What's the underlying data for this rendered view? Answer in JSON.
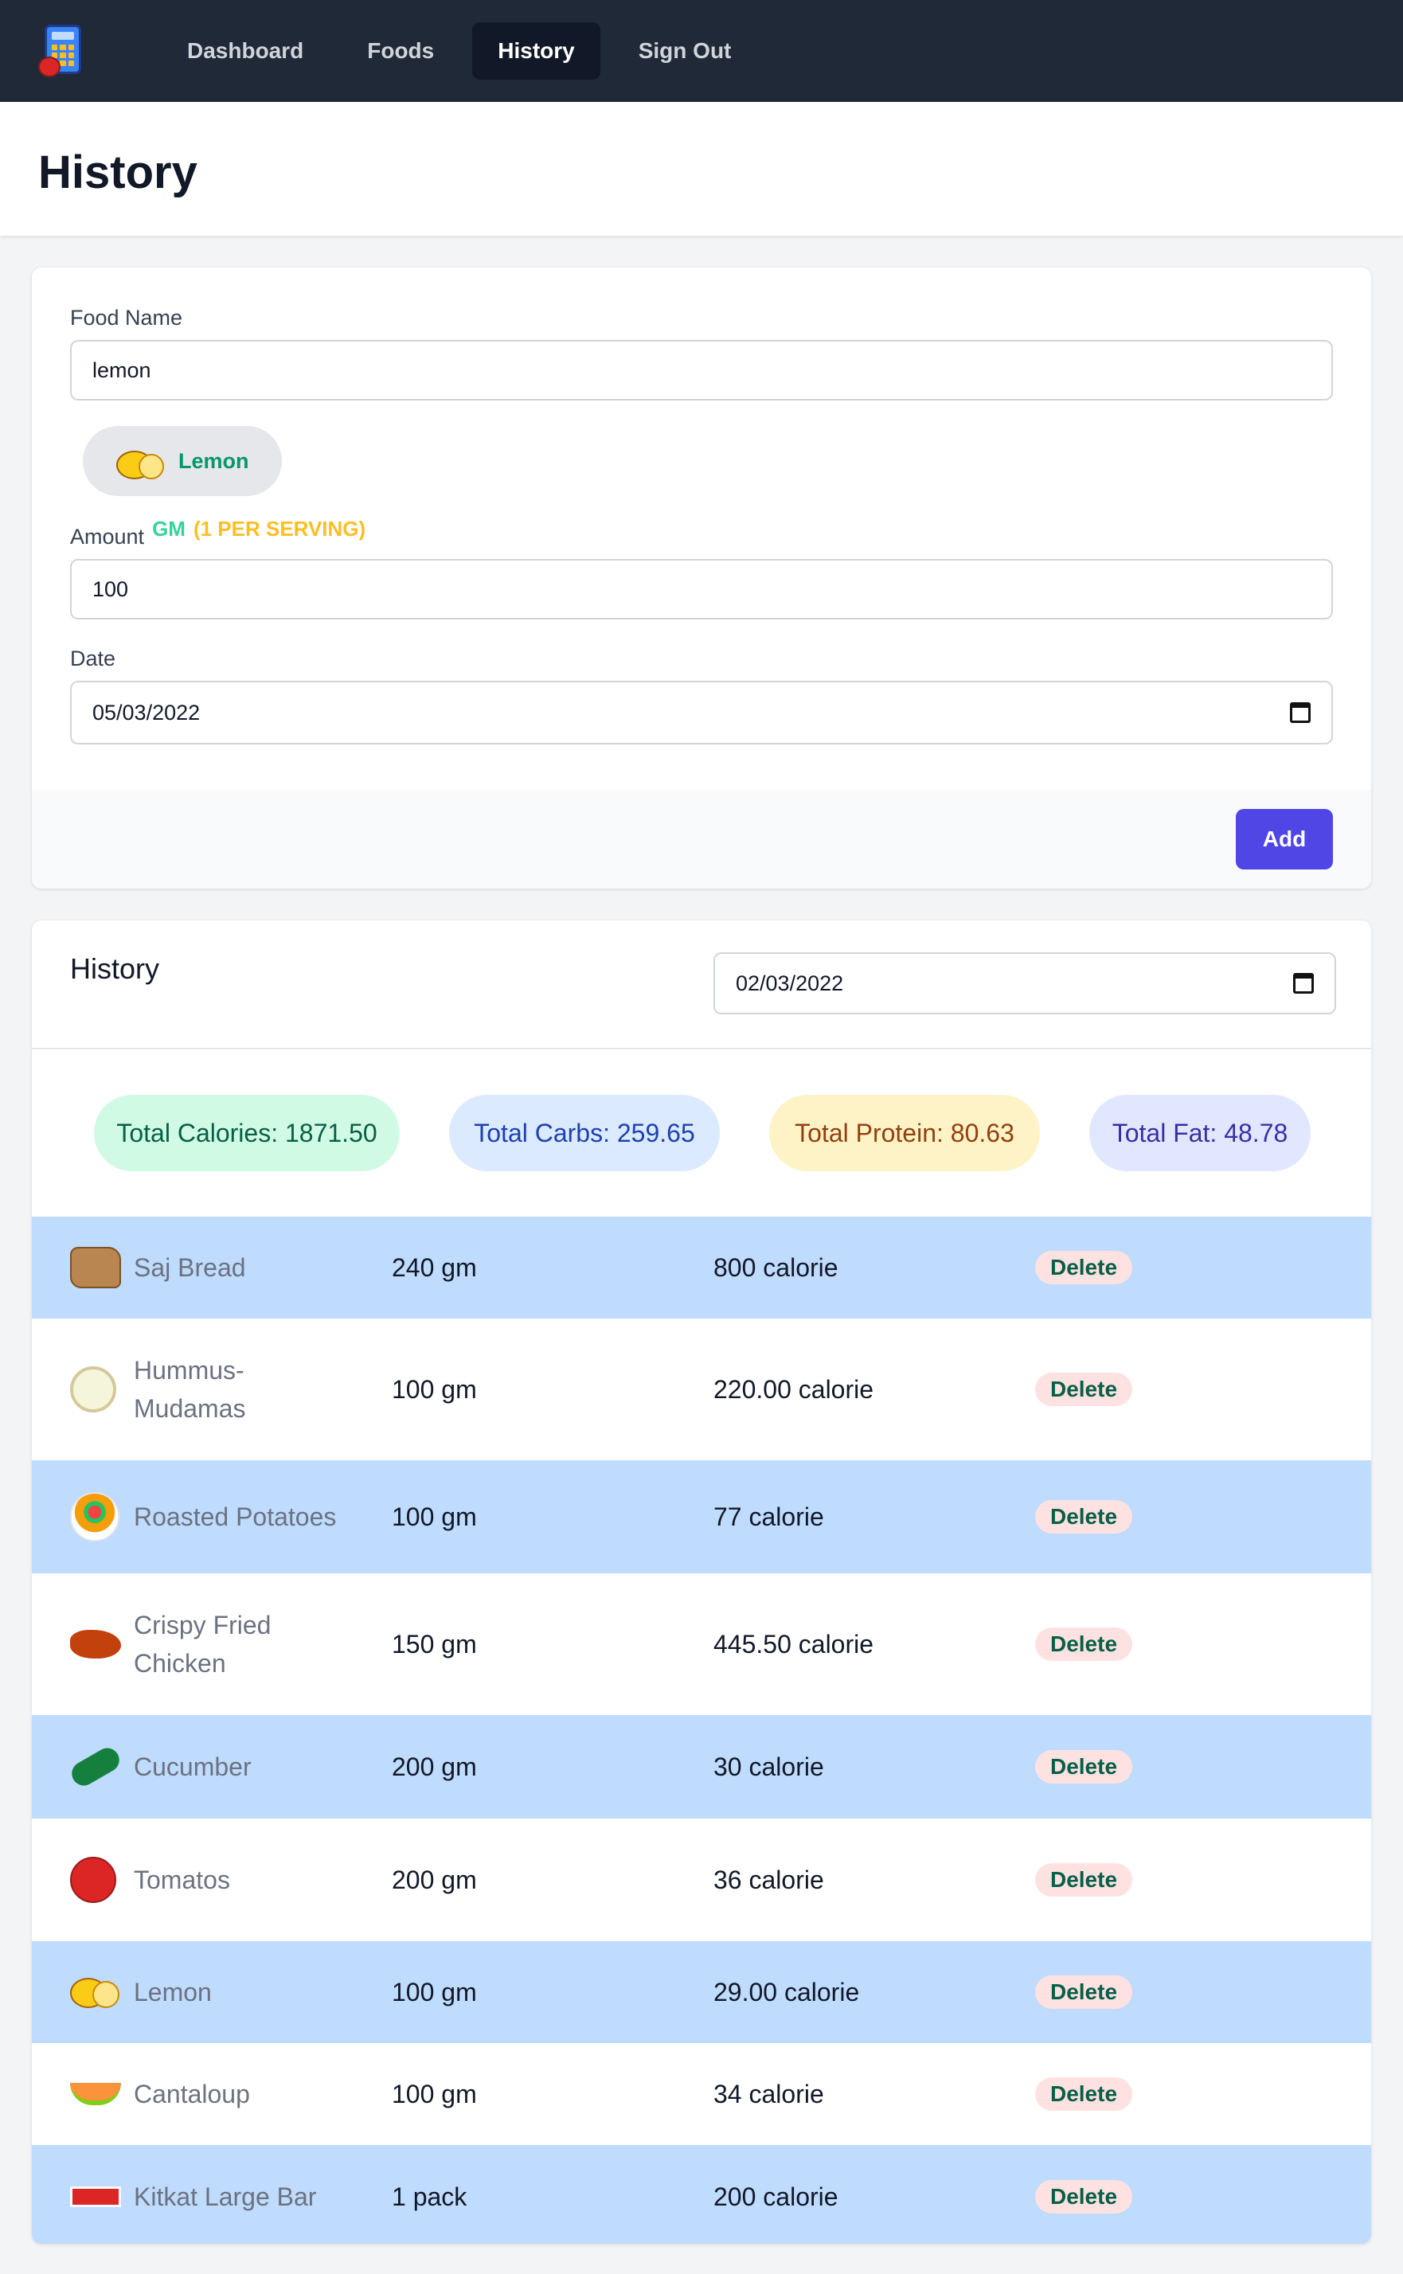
{
  "nav": {
    "items": [
      {
        "label": "Dashboard",
        "active": false
      },
      {
        "label": "Foods",
        "active": false
      },
      {
        "label": "History",
        "active": true
      },
      {
        "label": "Sign Out",
        "active": false
      }
    ]
  },
  "page": {
    "title": "History"
  },
  "form": {
    "food_name_label": "Food Name",
    "food_name_value": "lemon",
    "selected_food": "Lemon",
    "amount_label": "Amount",
    "unit": "GM",
    "serving_note": "(1 PER SERVING)",
    "amount_value": "100",
    "date_label": "Date",
    "date_value": "05/03/2022",
    "add_label": "Add"
  },
  "history": {
    "title": "History",
    "date_value": "02/03/2022",
    "totals": {
      "calories": "Total Calories: 1871.50",
      "carbs": "Total Carbs: 259.65",
      "protein": "Total Protein: 80.63",
      "fat": "Total Fat: 48.78"
    },
    "delete_label": "Delete",
    "rows": [
      {
        "name": "Saj Bread",
        "amount": "240 gm",
        "calories": "800 calorie",
        "icon": "bread-icon"
      },
      {
        "name": "Hummus-\nMudamas",
        "amount": "100 gm",
        "calories": "220.00 calorie",
        "icon": "hummus-icon"
      },
      {
        "name": "Roasted Potatoes",
        "amount": "100 gm",
        "calories": "77 calorie",
        "icon": "potato-bowl-icon"
      },
      {
        "name": "Crispy Fried\nChicken",
        "amount": "150 gm",
        "calories": "445.50 calorie",
        "icon": "fried-chicken-icon"
      },
      {
        "name": "Cucumber",
        "amount": "200 gm",
        "calories": "30 calorie",
        "icon": "cucumber-icon"
      },
      {
        "name": "Tomatos",
        "amount": "200 gm",
        "calories": "36 calorie",
        "icon": "tomato-icon"
      },
      {
        "name": "Lemon",
        "amount": "100 gm",
        "calories": "29.00 calorie",
        "icon": "lemon-icon"
      },
      {
        "name": "Cantaloup",
        "amount": "100 gm",
        "calories": "34 calorie",
        "icon": "cantaloupe-icon"
      },
      {
        "name": "Kitkat Large Bar",
        "amount": "1 pack",
        "calories": "200 calorie",
        "icon": "kitkat-icon"
      }
    ]
  },
  "colors": {
    "nav_bg": "#1f2937",
    "accent": "#4f46e5",
    "row_highlight": "#bfdbfe",
    "delete_bg": "#fee2e2"
  }
}
